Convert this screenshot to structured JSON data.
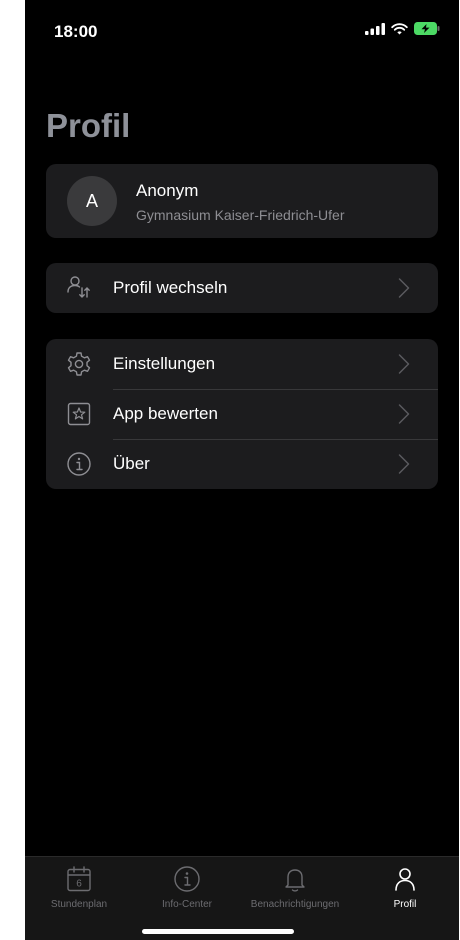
{
  "status_bar": {
    "time": "18:00"
  },
  "page": {
    "title": "Profil"
  },
  "profile": {
    "avatar_letter": "A",
    "name": "Anonym",
    "school": "Gymnasium Kaiser-Friedrich-Ufer"
  },
  "menu": {
    "switch_profile": "Profil wechseln",
    "settings": "Einstellungen",
    "rate_app": "App bewerten",
    "about": "Über"
  },
  "tabbar": {
    "items": [
      {
        "label": "Stundenplan",
        "icon": "calendar-icon",
        "calendar_number": "6"
      },
      {
        "label": "Info-Center",
        "icon": "info-icon"
      },
      {
        "label": "Benachrichtigungen",
        "icon": "bell-icon"
      },
      {
        "label": "Profil",
        "icon": "person-icon",
        "active": true
      }
    ]
  },
  "colors": {
    "background": "#000000",
    "card": "#1c1c1e",
    "title": "#8e9199",
    "inactive": "#6c6c70",
    "battery": "#4cd964"
  }
}
